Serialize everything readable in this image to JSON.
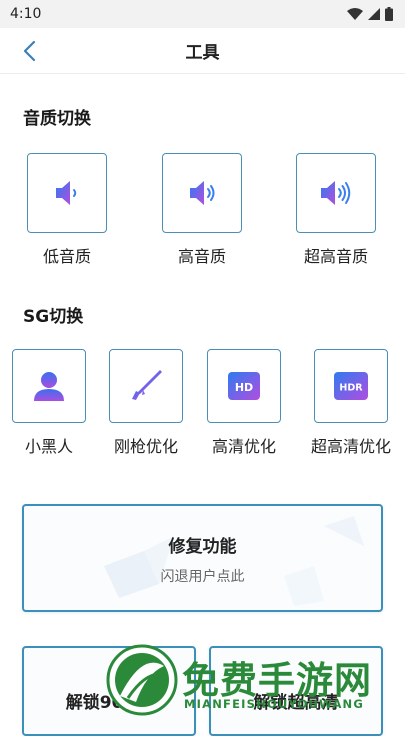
{
  "status_bar": {
    "time": "4:10"
  },
  "header": {
    "title": "工具"
  },
  "sections": {
    "audio": {
      "title": "音质切换",
      "items": [
        {
          "label": "低音质",
          "icon": "speaker-low-icon"
        },
        {
          "label": "高音质",
          "icon": "speaker-medium-icon"
        },
        {
          "label": "超高音质",
          "icon": "speaker-high-icon"
        }
      ]
    },
    "sg": {
      "title": "SG切换",
      "items": [
        {
          "label": "小黑人",
          "icon": "person-icon"
        },
        {
          "label": "刚枪优化",
          "icon": "rifle-icon"
        },
        {
          "label": "高清优化",
          "icon": "hd-icon",
          "badge": "HD"
        },
        {
          "label": "超高清优化",
          "icon": "hdr-icon",
          "badge": "HDR"
        }
      ]
    }
  },
  "repair_card": {
    "title": "修复功能",
    "subtitle": "闪退用户点此"
  },
  "bottom_cards": [
    {
      "title": "解锁90～1"
    },
    {
      "title": "解锁超高清"
    }
  ],
  "watermark": {
    "text": "免费手游网",
    "sub": "MIANFEISHOUYOUWANG"
  },
  "colors": {
    "accent": "#3c8fb8",
    "icon_gradient_start": "#2f7bf0",
    "icon_gradient_end": "#b24de0",
    "watermark": "#2a8a3a"
  }
}
